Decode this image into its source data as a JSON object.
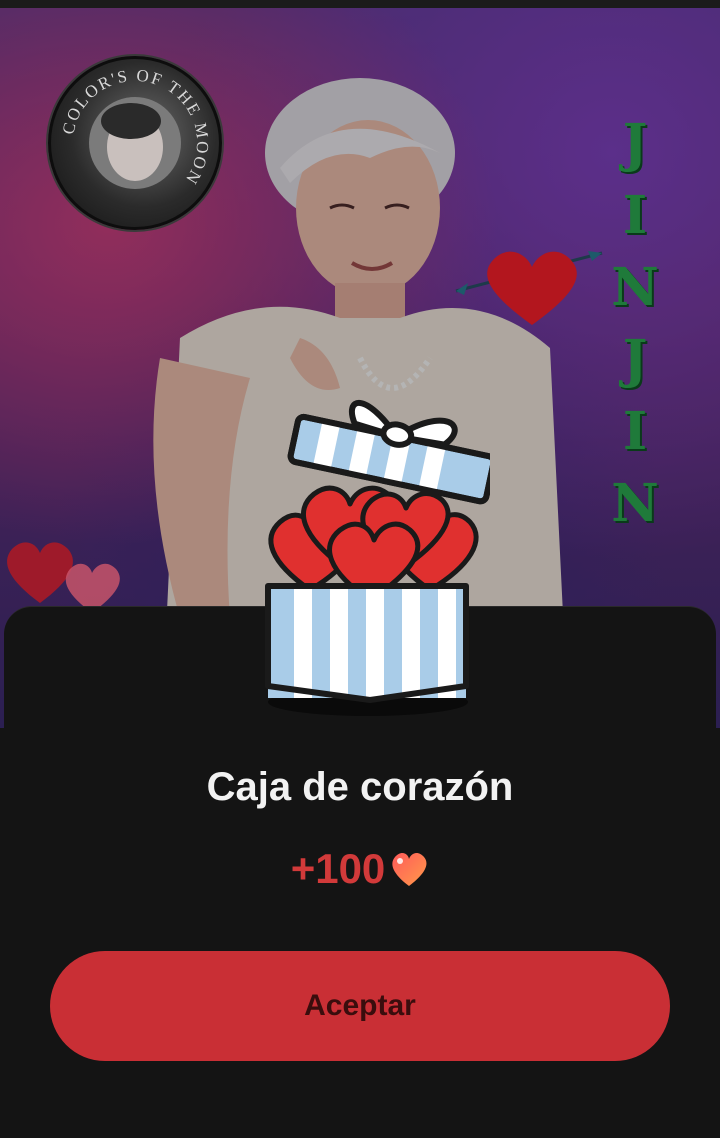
{
  "background": {
    "badge_text": "COLOR'S OF THE MOON",
    "vertical_name_letters": [
      "J",
      "I",
      "N",
      "J",
      "I",
      "N"
    ]
  },
  "dialog": {
    "title": "Caja de corazón",
    "reward_amount": "+100",
    "reward_icon": "heart-icon",
    "accept_label": "Aceptar"
  },
  "colors": {
    "accent": "#c92f35",
    "reward_text": "#d23a3a",
    "sheet_bg": "#141414",
    "name_green": "#1f7a3a"
  }
}
